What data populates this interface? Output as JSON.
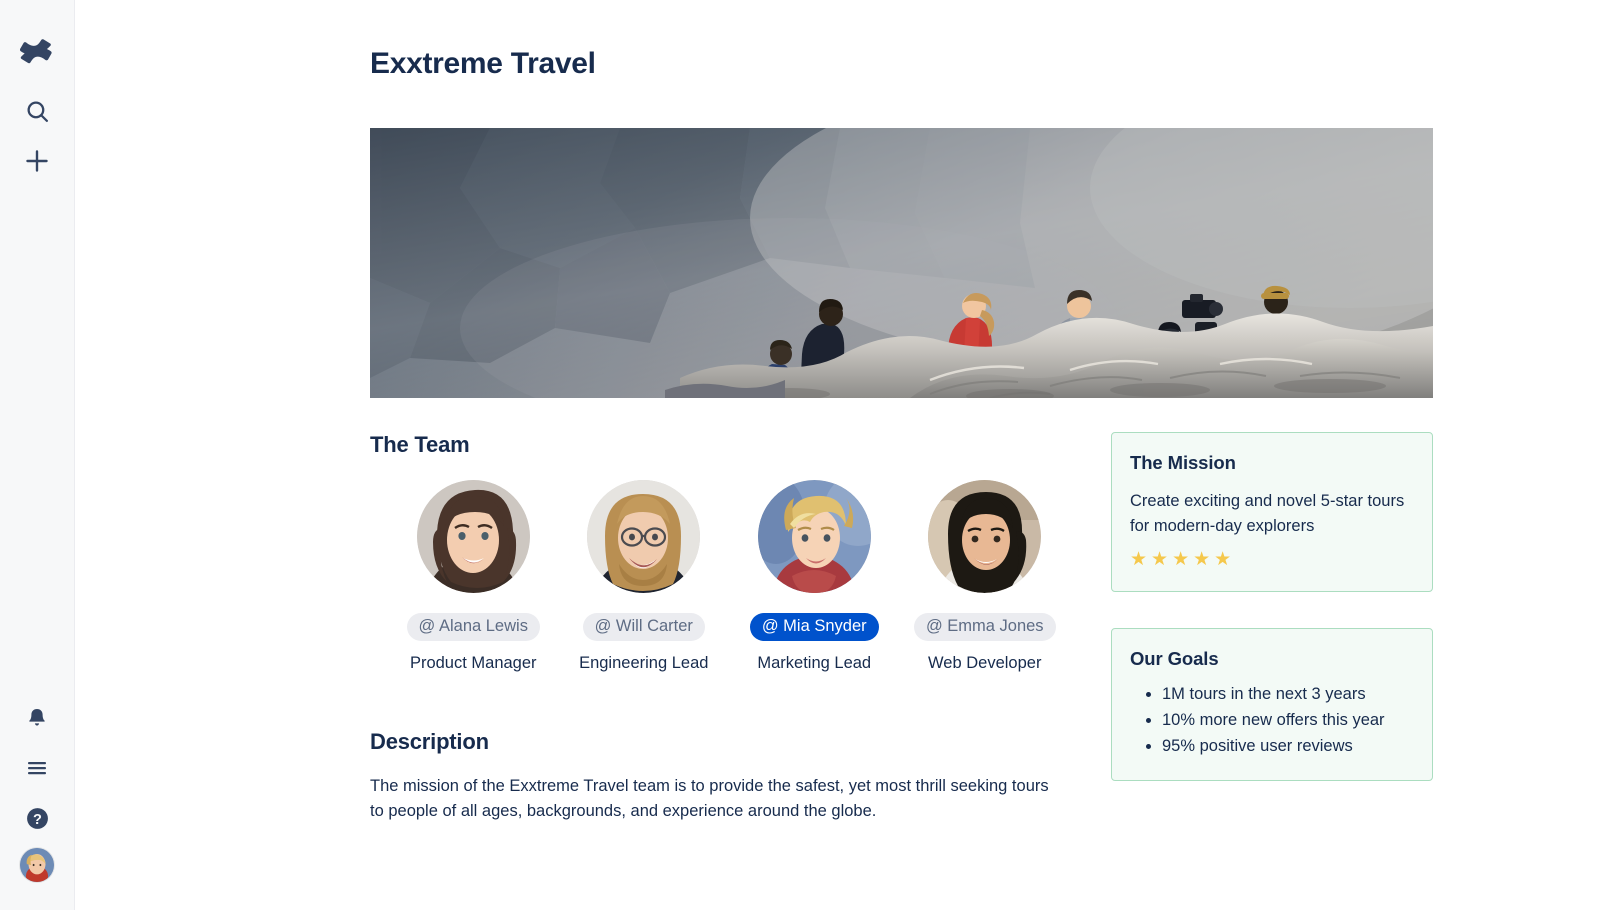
{
  "sidebar": {
    "logo_icon": "confluence-logo-icon",
    "top_items": [
      {
        "icon": "search-icon",
        "label": "Search"
      },
      {
        "icon": "plus-icon",
        "label": "Create"
      }
    ],
    "bottom_items": [
      {
        "icon": "bell-icon",
        "label": "Notifications"
      },
      {
        "icon": "hamburger-menu-icon",
        "label": "Menu"
      },
      {
        "icon": "help-icon",
        "label": "Help"
      }
    ],
    "avatar_label": "Your profile"
  },
  "header": {
    "title": "Exxtreme Travel"
  },
  "hero": {
    "alt": "Group of hikers and a photographer with a tripod sitting on grey rocks in front of a misty cliff"
  },
  "team": {
    "heading": "The Team",
    "members": [
      {
        "mention": "@ Alana Lewis",
        "role": "Product Manager",
        "active": false
      },
      {
        "mention": "@ Will Carter",
        "role": "Engineering Lead",
        "active": false
      },
      {
        "mention": "@ Mia Snyder",
        "role": "Marketing Lead",
        "active": true
      },
      {
        "mention": "@ Emma Jones",
        "role": "Web Developer",
        "active": false
      }
    ]
  },
  "description": {
    "heading": "Description",
    "body": "The mission of the Exxtreme Travel team is to provide the safest, yet most thrill seeking tours to people of all ages, backgrounds, and experience around the globe."
  },
  "mission_panel": {
    "title": "The Mission",
    "text": "Create exciting and novel 5-star tours for modern-day explorers",
    "stars": "★★★★★",
    "star_count": 5
  },
  "goals_panel": {
    "title": "Our Goals",
    "items": [
      "1M tours in the next 3 years",
      "10% more new offers this year",
      "95% positive user reviews"
    ]
  },
  "colors": {
    "accent_blue": "#0052cc",
    "text_dark": "#172b4d",
    "chip_grey_bg": "#ebecf0",
    "chip_grey_text": "#5e6c84",
    "panel_bg": "#f3faf6",
    "panel_border": "#abddc0",
    "star_gold": "#f5c84c",
    "sidebar_bg": "#f7f8f9"
  }
}
